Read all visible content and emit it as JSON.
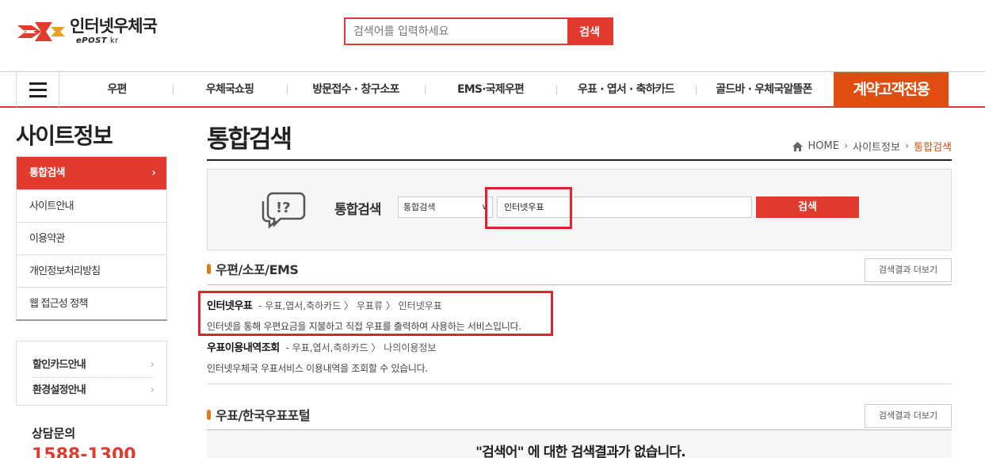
{
  "header": {
    "logo_text": "인터넷우체국",
    "logo_sub_brand": "ePOST",
    "logo_sub_domain": "kr",
    "search_placeholder": "검색어를 입력하세요",
    "search_button": "검색"
  },
  "gnb": {
    "items": [
      "우편",
      "우체국쇼핑",
      "방문접수 · 창구소포",
      "EMS·국제우편",
      "우표 · 엽서 · 축하카드",
      "골드바 · 우체국알뜰폰"
    ],
    "special": "계약고객전용"
  },
  "sidebar": {
    "title": "사이트정보",
    "items": [
      {
        "label": "통합검색",
        "active": true,
        "arrow": "›"
      },
      {
        "label": "사이트안내"
      },
      {
        "label": "이용약관"
      },
      {
        "label": "개인정보처리방침"
      },
      {
        "label": "웹 접근성 정책"
      }
    ],
    "box_items": [
      {
        "label": "할인카드안내",
        "arrow": "›"
      },
      {
        "label": "환경설정안내",
        "arrow": "›"
      }
    ],
    "cs_title": "상담문의",
    "cs_number": "1588-1300"
  },
  "main": {
    "title": "통합검색",
    "breadcrumb": [
      "HOME",
      "사이트정보",
      "통합검색"
    ],
    "search_panel": {
      "label": "통합검색",
      "select_value": "통합검색",
      "input_value": "인터넷우표",
      "button": "검색"
    },
    "sections": [
      {
        "title": "우편/소포/EMS",
        "more": "검색결과 더보기",
        "results": [
          {
            "title": "인터넷우표",
            "path": "- 우표,엽서,축하카드 〉 우표류 〉 인터넷우표",
            "desc": "인터넷을 통해 우편요금을 지불하고 직접 우표를 출력하여 사용하는 서비스입니다."
          },
          {
            "title": "우표이용내역조회",
            "path": "- 우표,엽서,축하카드 〉 나의이용정보",
            "desc": "인터넷우체국 우표서비스 이용내역을 조회할 수 있습니다."
          }
        ]
      },
      {
        "title": "우표/한국우표포털",
        "more": "검색결과 더보기",
        "empty_message": "\"검색어\" 에 대한 검색결과가 없습니다."
      }
    ]
  },
  "colors": {
    "accent": "#e13a2e",
    "special": "#e14d0f",
    "highlight": "#e0232f"
  }
}
